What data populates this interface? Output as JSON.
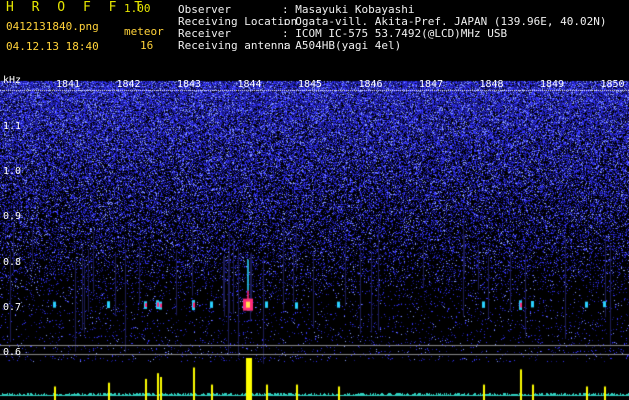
{
  "app": {
    "name": "H R O F F T",
    "version": "1.00"
  },
  "file": {
    "name": "0412131840.png",
    "datetime": "04.12.13 18:40"
  },
  "meteor": {
    "label": "meteor",
    "count": "16"
  },
  "station": [
    {
      "key": "Observer",
      "value": ": Masayuki Kobayashi"
    },
    {
      "key": "Receiving Location",
      "value": ": Ogata-vill. Akita-Pref. JAPAN (139.96E, 40.02N)"
    },
    {
      "key": "Receiver",
      "value": ": ICOM IC-575 53.7492(@LCD)MHz USB"
    },
    {
      "key": "Receiving antenna",
      "value": ": A504HB(yagi 4el)"
    }
  ],
  "chart_data": {
    "type": "heatmap",
    "xlabel": "",
    "ylabel": "kHz",
    "x_ticks": [
      "1841",
      "1842",
      "1843",
      "1844",
      "1845",
      "1846",
      "1847",
      "1848",
      "1849",
      "1850"
    ],
    "y_ticks": [
      "1.1",
      "1.0",
      "0.9",
      "0.8",
      "0.7",
      "0.6"
    ],
    "ylim": [
      0.58,
      1.2
    ],
    "colors": {
      "background": "#1a1a8c",
      "noise": "#3a3aff",
      "echo_core": "#ff2a7a",
      "echo_halo": "#2ad1ff",
      "level_bar": "#ffff00",
      "level_floor": "#30d0c0"
    },
    "meteor_events": [
      {
        "time": "1840.8",
        "freq_khz": 0.707,
        "strength": 0.25
      },
      {
        "time": "1841.7",
        "freq_khz": 0.707,
        "strength": 0.35
      },
      {
        "time": "1842.3",
        "freq_khz": 0.706,
        "strength": 0.45
      },
      {
        "time": "1842.5",
        "freq_khz": 0.707,
        "strength": 0.6
      },
      {
        "time": "1842.55",
        "freq_khz": 0.705,
        "strength": 0.5
      },
      {
        "time": "1843.1",
        "freq_khz": 0.706,
        "strength": 0.75
      },
      {
        "time": "1843.4",
        "freq_khz": 0.707,
        "strength": 0.3
      },
      {
        "time": "1844.0",
        "freq_khz": 0.707,
        "strength": 1.0
      },
      {
        "time": "1844.3",
        "freq_khz": 0.707,
        "strength": 0.3
      },
      {
        "time": "1844.8",
        "freq_khz": 0.705,
        "strength": 0.3
      },
      {
        "time": "1845.5",
        "freq_khz": 0.707,
        "strength": 0.25
      },
      {
        "time": "1847.9",
        "freq_khz": 0.707,
        "strength": 0.3
      },
      {
        "time": "1848.5",
        "freq_khz": 0.706,
        "strength": 0.7
      },
      {
        "time": "1848.7",
        "freq_khz": 0.708,
        "strength": 0.3
      },
      {
        "time": "1849.6",
        "freq_khz": 0.707,
        "strength": 0.25
      },
      {
        "time": "1849.9",
        "freq_khz": 0.708,
        "strength": 0.25
      }
    ]
  }
}
